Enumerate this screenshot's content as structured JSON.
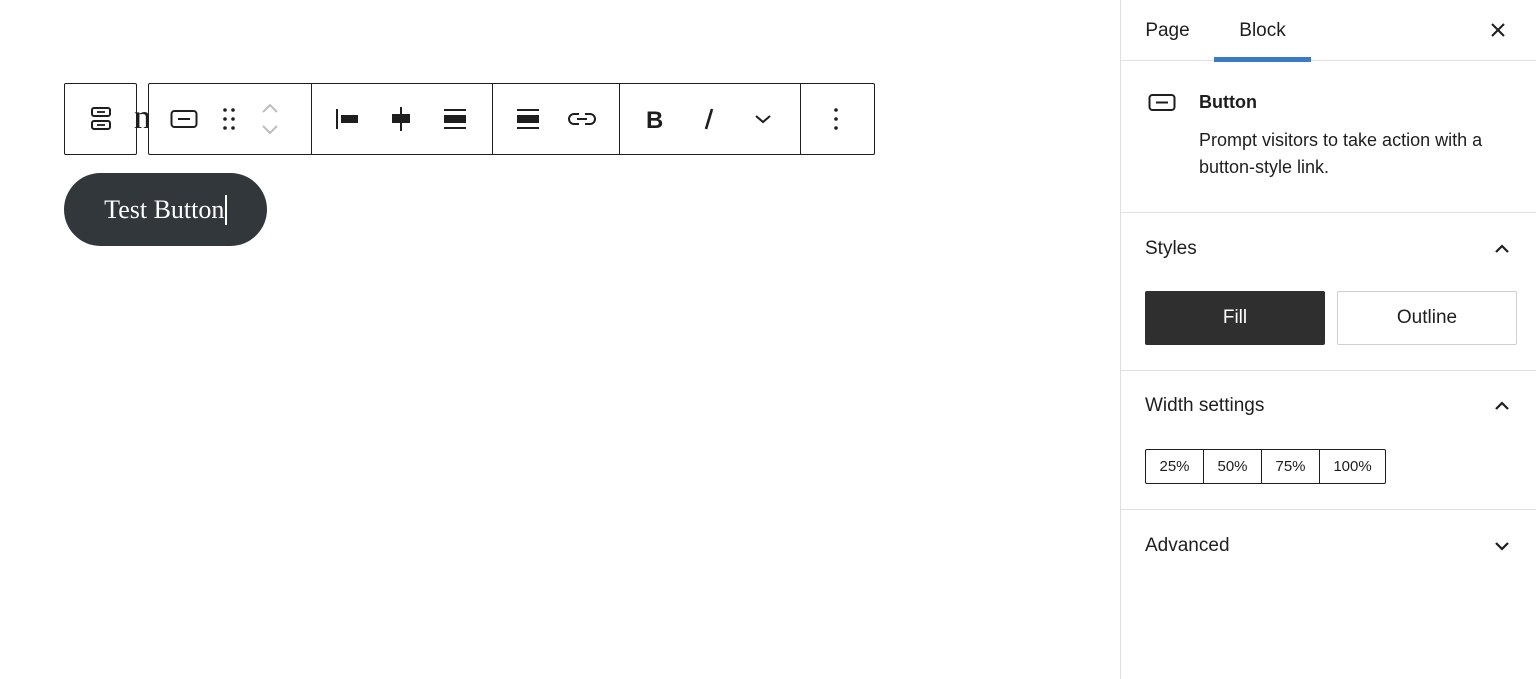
{
  "toolbar": {
    "parent_icon": "buttons-parent-icon",
    "behind_glyph": "n",
    "groups": [
      [
        "button-block-icon",
        "drag-handle-icon",
        "move-up-icon",
        "move-down-icon"
      ],
      [
        "justify-left-icon",
        "justify-center-icon",
        "justify-space-between-icon"
      ],
      [
        "vertical-align-icon",
        "link-icon"
      ],
      [
        "bold-icon",
        "italic-icon",
        "more-rich-text-icon"
      ],
      [
        "options-icon"
      ]
    ]
  },
  "canvas": {
    "button_text": "Test Button"
  },
  "sidebar": {
    "tabs": [
      {
        "label": "Page",
        "active": false
      },
      {
        "label": "Block",
        "active": true
      }
    ],
    "close_icon": "close-icon",
    "block_card": {
      "icon": "button-block-icon",
      "title": "Button",
      "description": "Prompt visitors to take action with a button-style link."
    },
    "styles": {
      "title": "Styles",
      "expanded": true,
      "options": [
        {
          "label": "Fill",
          "selected": true
        },
        {
          "label": "Outline",
          "selected": false
        }
      ]
    },
    "width_settings": {
      "title": "Width settings",
      "expanded": true,
      "options": [
        "25%",
        "50%",
        "75%",
        "100%"
      ]
    },
    "advanced": {
      "title": "Advanced",
      "expanded": false
    }
  },
  "colors": {
    "accent": "#3a7bc6",
    "button_bg": "#32373c",
    "fill_bg": "#2f2f2f",
    "text": "#1e1e1e",
    "border": "#e0e0e0"
  }
}
